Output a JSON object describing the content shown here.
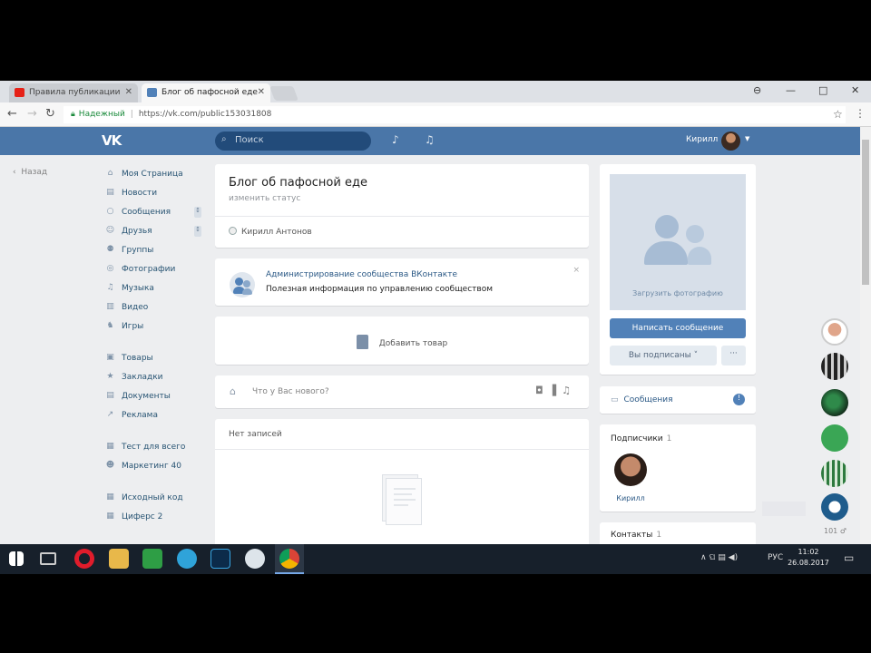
{
  "browser": {
    "tabs": [
      {
        "title": "Правила публикации",
        "favicon_color": "#e62117"
      },
      {
        "title": "Блог об пафосной еде",
        "favicon_color": "#5181b8"
      }
    ],
    "window_controls": {
      "profile": "⊖",
      "minimize": "—",
      "maximize": "□",
      "close": "✕"
    },
    "nav": {
      "back": "←",
      "forward": "→",
      "reload": "↻"
    },
    "address": {
      "secure_label": "Надежный",
      "url": "https://vk.com/public153031808"
    },
    "star_icon": "☆",
    "menu_icon": "⋮"
  },
  "vk": {
    "logo": "VK",
    "search_placeholder": "Поиск",
    "user_name": "Кирилл"
  },
  "left_nav": {
    "back_label": "Назад",
    "items": [
      {
        "icon": "⌂",
        "label": "Моя Страница"
      },
      {
        "icon": "▤",
        "label": "Новости"
      },
      {
        "icon": "○",
        "label": "Сообщения",
        "badge": "↕"
      },
      {
        "icon": "☺",
        "label": "Друзья",
        "badge": "↕"
      },
      {
        "icon": "⚉",
        "label": "Группы"
      },
      {
        "icon": "◎",
        "label": "Фотографии"
      },
      {
        "icon": "♫",
        "label": "Музыка"
      },
      {
        "icon": "▥",
        "label": "Видео"
      },
      {
        "icon": "♞",
        "label": "Игры"
      }
    ],
    "items2": [
      {
        "icon": "▣",
        "label": "Товары"
      },
      {
        "icon": "★",
        "label": "Закладки"
      },
      {
        "icon": "▤",
        "label": "Документы"
      },
      {
        "icon": "↗",
        "label": "Реклама"
      }
    ],
    "items3": [
      {
        "icon": "▦",
        "label": "Тест для всего"
      },
      {
        "icon": "☻",
        "label": "Маркетинг 40"
      }
    ],
    "items4": [
      {
        "icon": "▦",
        "label": "Исходный код"
      },
      {
        "icon": "▦",
        "label": "Циферс 2"
      }
    ]
  },
  "group": {
    "title": "Блог об пафосной еде",
    "status": "изменить статус",
    "owner": "Кирилл Антонов"
  },
  "admin_banner": {
    "title": "Администрирование сообщества ВКонтакте",
    "subtitle": "Полезная информация по управлению сообществом",
    "close": "×"
  },
  "products": {
    "add_label": "Добавить товар"
  },
  "post_box": {
    "placeholder": "Что у Вас нового?",
    "icons": "◘▐♫"
  },
  "wall": {
    "empty_label": "Нет записей"
  },
  "right": {
    "upload_photo": "Загрузить фотографию",
    "message_button": "Написать сообщение",
    "subscribed_button": "Вы подписаны ˅",
    "more_button": "···",
    "messages_label": "Сообщения",
    "messages_info": "!",
    "subscribers_title": "Подписчики",
    "subscribers_count": "1",
    "subscriber_name": "Кирилл",
    "contacts_title": "Контакты",
    "contacts_count": "1"
  },
  "dock": {
    "count_label": "101 ♂"
  },
  "taskbar": {
    "tray_icons": "∧  ଘ  ▤  ◀)",
    "lang": "РУС",
    "time": "11:02",
    "date": "26.08.2017"
  }
}
